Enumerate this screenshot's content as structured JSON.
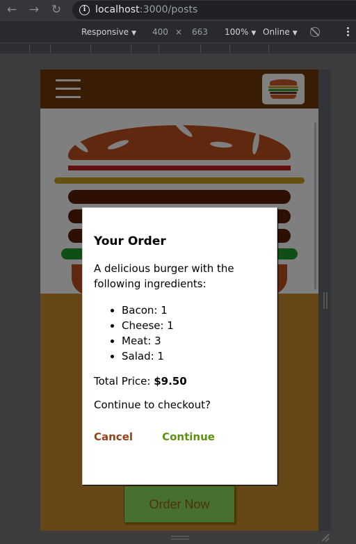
{
  "browser": {
    "url_host": "localhost",
    "url_path": ":3000/posts"
  },
  "devtools": {
    "device": "Responsive",
    "width": "400",
    "times": "×",
    "height": "663",
    "zoom": "100%",
    "network": "Online"
  },
  "modal": {
    "title": "Your Order",
    "description": "A delicious burger with the following ingredients:",
    "ingredients": [
      {
        "label": "Bacon: 1"
      },
      {
        "label": "Cheese: 1"
      },
      {
        "label": "Meat: 3"
      },
      {
        "label": "Salad: 1"
      }
    ],
    "total_label": "Total Price: ",
    "total_value": "$9.50",
    "question": "Continue to checkout?",
    "cancel_label": "Cancel",
    "continue_label": "Continue"
  },
  "controls": {
    "order_now_label": "Order Now"
  },
  "colors": {
    "toolbar": "#703b09",
    "cancel": "#944317",
    "continue": "#5c9210"
  }
}
